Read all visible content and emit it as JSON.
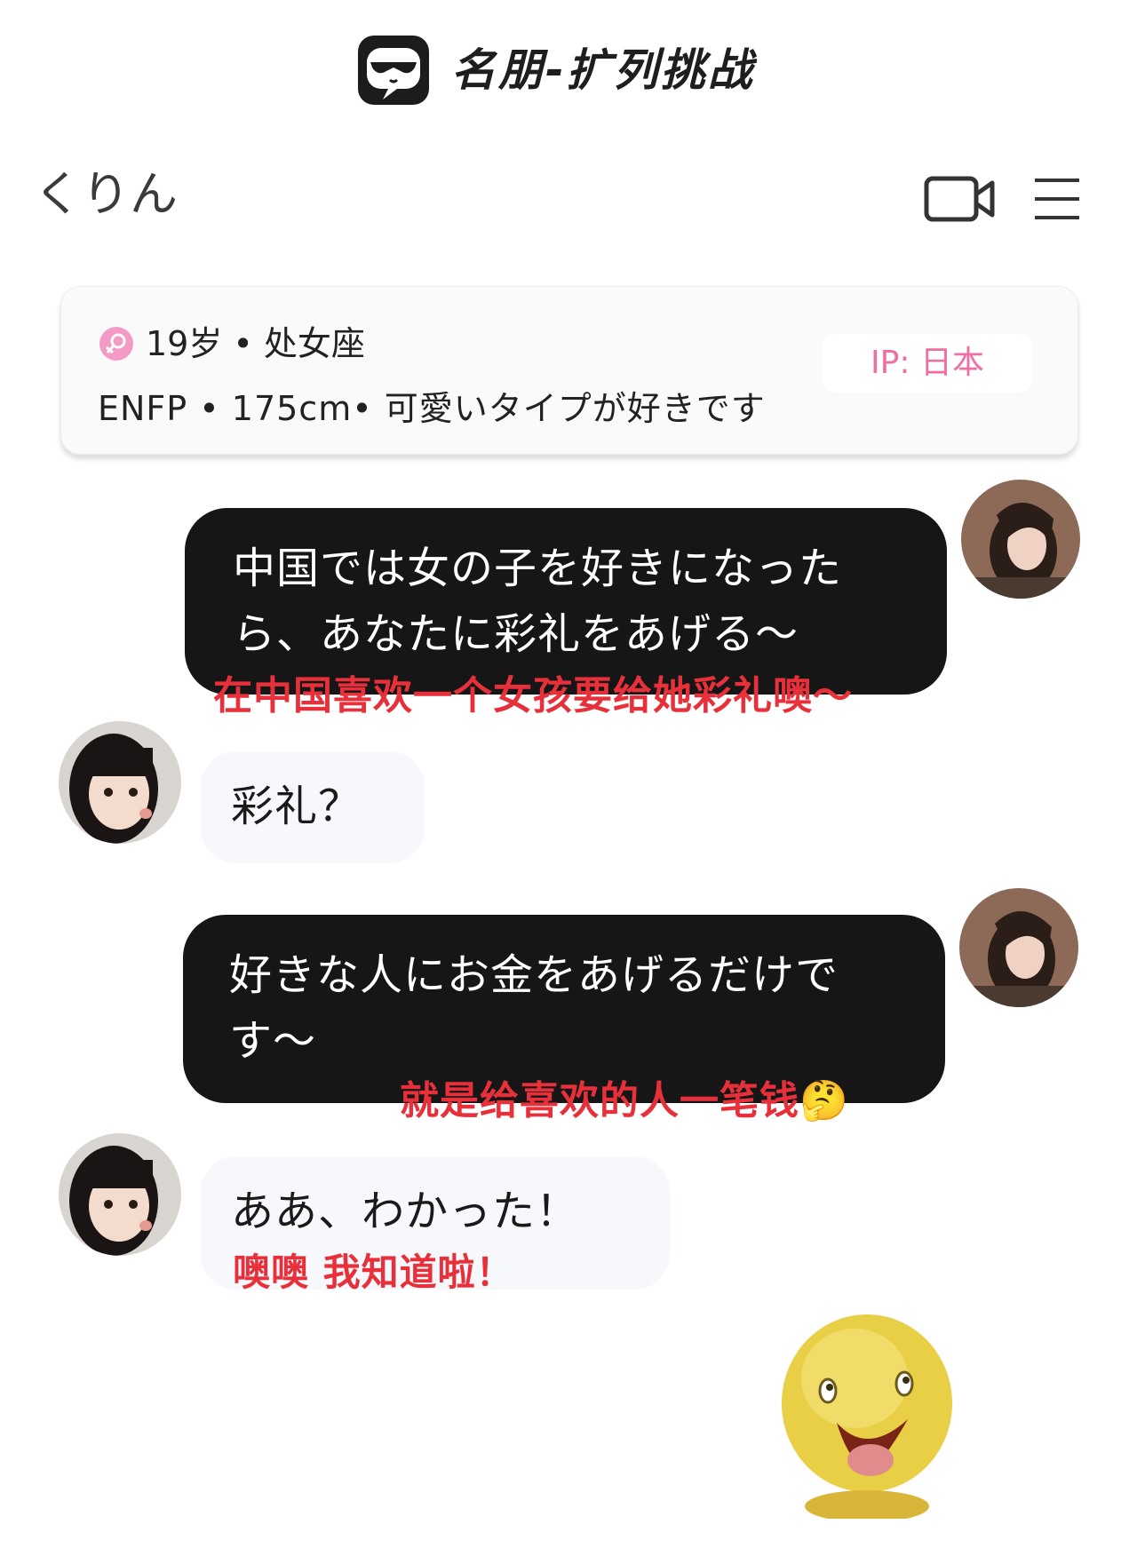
{
  "app": {
    "app_title": "名朋-扩列挑战",
    "logo_icon": "sunglasses-face-logo-icon"
  },
  "header": {
    "contact_name": "くりん",
    "video_icon": "video-camera-icon",
    "menu_icon": "menu-icon"
  },
  "profile": {
    "age_line": "19岁 • 处女座",
    "traits_line": "ENFP • 175cm• 可愛いタイプが好きです",
    "ip": "IP: 日本",
    "gender_icon": "female-icon",
    "accent_color": "#ee6fa4"
  },
  "messages": [
    {
      "sender": "me",
      "lines": [
        "中国では女の子を好きになった",
        "ら、あなたに彩礼をあげる～"
      ],
      "translation": "在中国喜欢一个女孩要给她彩礼噢～"
    },
    {
      "sender": "contact",
      "lines": [
        "彩礼？"
      ]
    },
    {
      "sender": "me",
      "lines": [
        "好きな人にお金をあげるだけで",
        "す～"
      ],
      "translation": "就是给喜欢的人一笔钱",
      "translation_emoji": "🤔"
    },
    {
      "sender": "contact",
      "lines": [
        "ああ、わかった！"
      ],
      "translation": "噢噢 我知道啦！"
    }
  ],
  "sticker": {
    "name": "smiling-yellow-face-sticker"
  },
  "colors": {
    "dark_bubble": "#161616",
    "light_bubble": "#f6f8fb",
    "caption_red": "#e8303b"
  }
}
